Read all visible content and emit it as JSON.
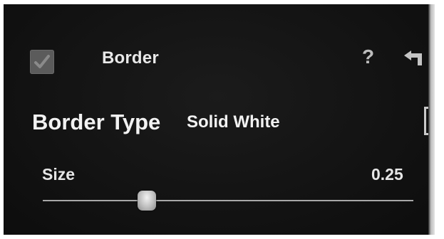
{
  "panel": {
    "title": "Border",
    "enabled": true,
    "help_label": "?",
    "icons": {
      "checkbox": "checkmark-icon",
      "help": "question-mark-icon",
      "reset": "undo-arrow-icon"
    }
  },
  "border_type": {
    "label": "Border Type",
    "value": "Solid White"
  },
  "size": {
    "label": "Size",
    "value": "0.25",
    "slider_fraction": 0.28
  },
  "colors": {
    "panel_background": "#131313",
    "text": "#e9e9e9",
    "track": "#a8a8a8"
  }
}
